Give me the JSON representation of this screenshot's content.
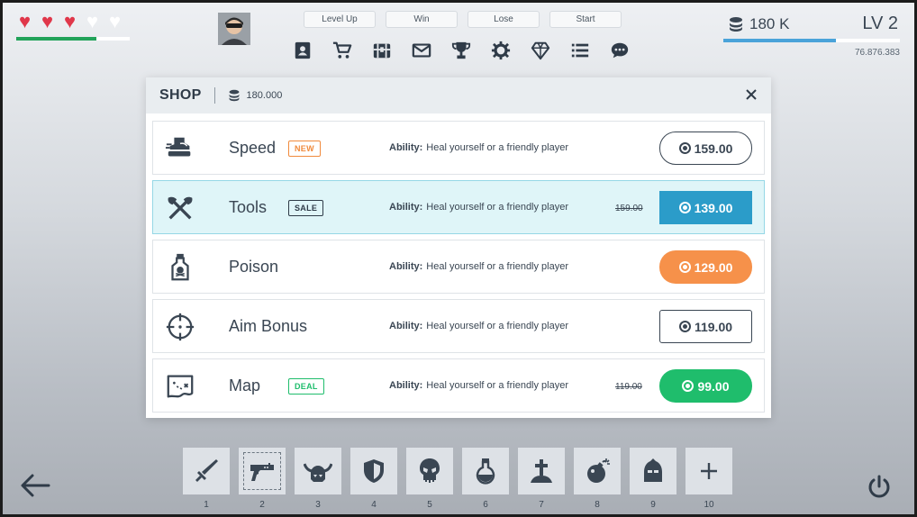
{
  "hud": {
    "hearts": [
      {
        "state": "full",
        "icon": "heart-icon"
      },
      {
        "state": "full",
        "icon": "heart-icon"
      },
      {
        "state": "full",
        "icon": "heart-icon"
      },
      {
        "state": "empty",
        "icon": "heart-icon"
      },
      {
        "state": "empty",
        "icon": "heart-icon"
      }
    ],
    "health_fraction": 0.71,
    "debug_buttons": [
      "Level Up",
      "Win",
      "Lose",
      "Start"
    ],
    "menu_icons": [
      "profile-icon",
      "cart-icon",
      "chest-icon",
      "mail-icon",
      "trophy-icon",
      "settings-icon",
      "gem-icon",
      "list-icon",
      "chat-icon"
    ],
    "coins": "180 K",
    "level": "LV 2",
    "xp_fraction": 0.64,
    "xp_value": "76.876.383"
  },
  "shop": {
    "title": "SHOP",
    "balance": "180.000",
    "items": [
      {
        "name": "Speed",
        "icon": "boot-icon",
        "tag": "NEW",
        "ability_label": "Ability:",
        "ability_text": "Heal yourself or a friendly player",
        "old_price": "",
        "price": "159.00",
        "style": "outline-round"
      },
      {
        "name": "Tools",
        "icon": "axes-icon",
        "tag": "SALE",
        "ability_label": "Ability:",
        "ability_text": "Heal yourself or a friendly player",
        "old_price": "159.00",
        "price": "139.00",
        "style": "blue"
      },
      {
        "name": "Poison",
        "icon": "poison-icon",
        "tag": "",
        "ability_label": "Ability:",
        "ability_text": "Heal yourself or a friendly player",
        "old_price": "",
        "price": "129.00",
        "style": "orange"
      },
      {
        "name": "Aim Bonus",
        "icon": "crosshair-icon",
        "tag": "",
        "ability_label": "Ability:",
        "ability_text": "Heal yourself or a friendly player",
        "old_price": "",
        "price": "119.00",
        "style": "outline-square"
      },
      {
        "name": "Map",
        "icon": "map-icon",
        "tag": "DEAL",
        "ability_label": "Ability:",
        "ability_text": "Heal yourself or a friendly player",
        "old_price": "119.00",
        "price": "99.00",
        "style": "green"
      }
    ],
    "tag_colors": {
      "NEW": "#f08a3c",
      "SALE": "#2f3b48",
      "DEAL": "#1fbd6c"
    }
  },
  "hotbar": {
    "slots": [
      {
        "num": "1",
        "icon": "sword-icon"
      },
      {
        "num": "2",
        "icon": "gun-icon"
      },
      {
        "num": "3",
        "icon": "viking-helmet-icon"
      },
      {
        "num": "4",
        "icon": "shield-icon"
      },
      {
        "num": "5",
        "icon": "skull-icon"
      },
      {
        "num": "6",
        "icon": "potion-icon"
      },
      {
        "num": "7",
        "icon": "grave-icon"
      },
      {
        "num": "8",
        "icon": "bomb-icon"
      },
      {
        "num": "9",
        "icon": "hood-icon"
      },
      {
        "num": "10",
        "icon": "plus-icon"
      }
    ],
    "selected": "2"
  },
  "colors": {
    "accent_blue": "#2b9cc9",
    "heart_red": "#e0374a",
    "health_green": "#22a35a",
    "xp_blue": "#4aa3d9",
    "orange": "#f6914a",
    "green": "#1fbd6c"
  }
}
